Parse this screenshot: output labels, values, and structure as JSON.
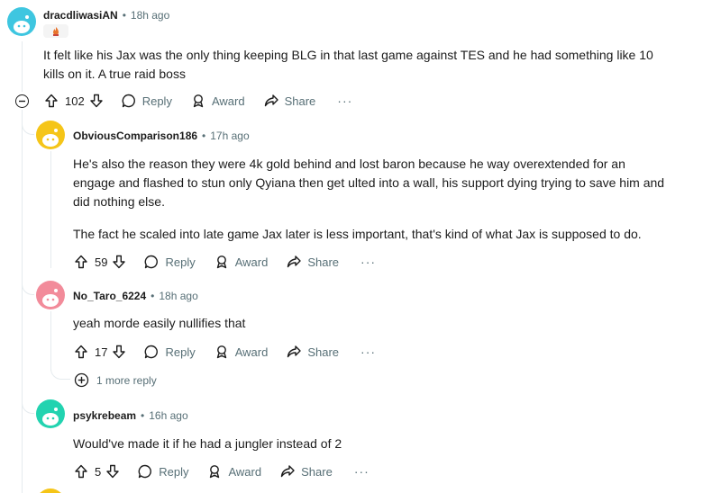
{
  "comments": [
    {
      "username": "dracdliwasiAN",
      "time": "18h ago",
      "body": "It felt like his Jax was the only thing keeping BLG in that last game against TES and he had something like 10 kills on it. A true raid boss",
      "votes": "102",
      "avatar_color": "#3ec6e0"
    },
    {
      "username": "ObviousComparison186",
      "time": "17h ago",
      "body_p1": "He's also the reason they were 4k gold behind and lost baron because he way overextended for an engage and flashed to stun only Qyiana then get ulted into a wall, his support dying trying to save him and did nothing else.",
      "body_p2": "The fact he scaled into late game Jax later is less important, that's kind of what Jax is supposed to do.",
      "votes": "59",
      "avatar_color": "#f5c518"
    },
    {
      "username": "No_Taro_6224",
      "time": "18h ago",
      "body": "yeah morde easily nullifies that",
      "votes": "17",
      "avatar_color": "#f28b9a"
    },
    {
      "username": "psykrebeam",
      "time": "16h ago",
      "body": "Would've made it if he had a jungler instead of 2",
      "votes": "5",
      "avatar_color": "#22d3b0"
    }
  ],
  "labels": {
    "reply": "Reply",
    "award": "Award",
    "share": "Share",
    "more_replies": "1 more reply",
    "dot": "•",
    "overflow": "···"
  },
  "colors": {
    "meta_gray": "#576f76",
    "text": "#1c1c1c",
    "thread_line": "#e5ebee"
  }
}
